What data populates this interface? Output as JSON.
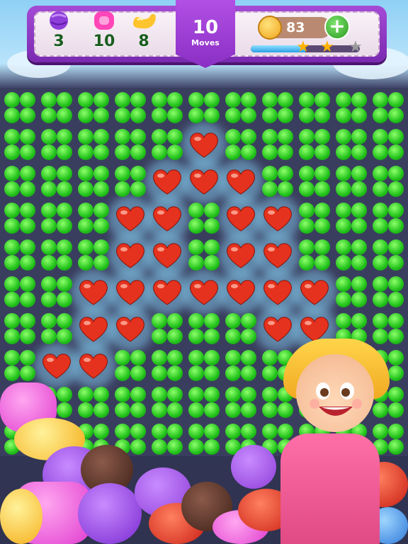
{
  "hud": {
    "goals": [
      {
        "icon": "purple-lollipop-icon",
        "count": "3",
        "color": "#8e3ed8"
      },
      {
        "icon": "pink-candy-icon",
        "count": "10",
        "color": "#ff46b8"
      },
      {
        "icon": "yellow-jellybean-icon",
        "count": "8",
        "color": "#ffc42e"
      }
    ],
    "moves_value": "10",
    "moves_label": "Moves",
    "coins": "83",
    "add_label": "+",
    "progress": 0.5,
    "stars_earned": 2,
    "stars_total": 3
  },
  "board": {
    "cols": 11,
    "rows": 10,
    "hearts": [
      [
        1,
        5
      ],
      [
        2,
        4
      ],
      [
        2,
        5
      ],
      [
        2,
        6
      ],
      [
        3,
        3
      ],
      [
        3,
        4
      ],
      [
        3,
        6
      ],
      [
        3,
        7
      ],
      [
        4,
        3
      ],
      [
        4,
        4
      ],
      [
        4,
        6
      ],
      [
        4,
        7
      ],
      [
        5,
        2
      ],
      [
        5,
        3
      ],
      [
        5,
        4
      ],
      [
        5,
        5
      ],
      [
        5,
        6
      ],
      [
        5,
        7
      ],
      [
        5,
        8
      ],
      [
        6,
        2
      ],
      [
        6,
        3
      ],
      [
        6,
        7
      ],
      [
        6,
        8
      ],
      [
        7,
        1
      ],
      [
        7,
        2
      ]
    ],
    "heart_color": "#e5321e",
    "clover_color": "#21c21a"
  }
}
